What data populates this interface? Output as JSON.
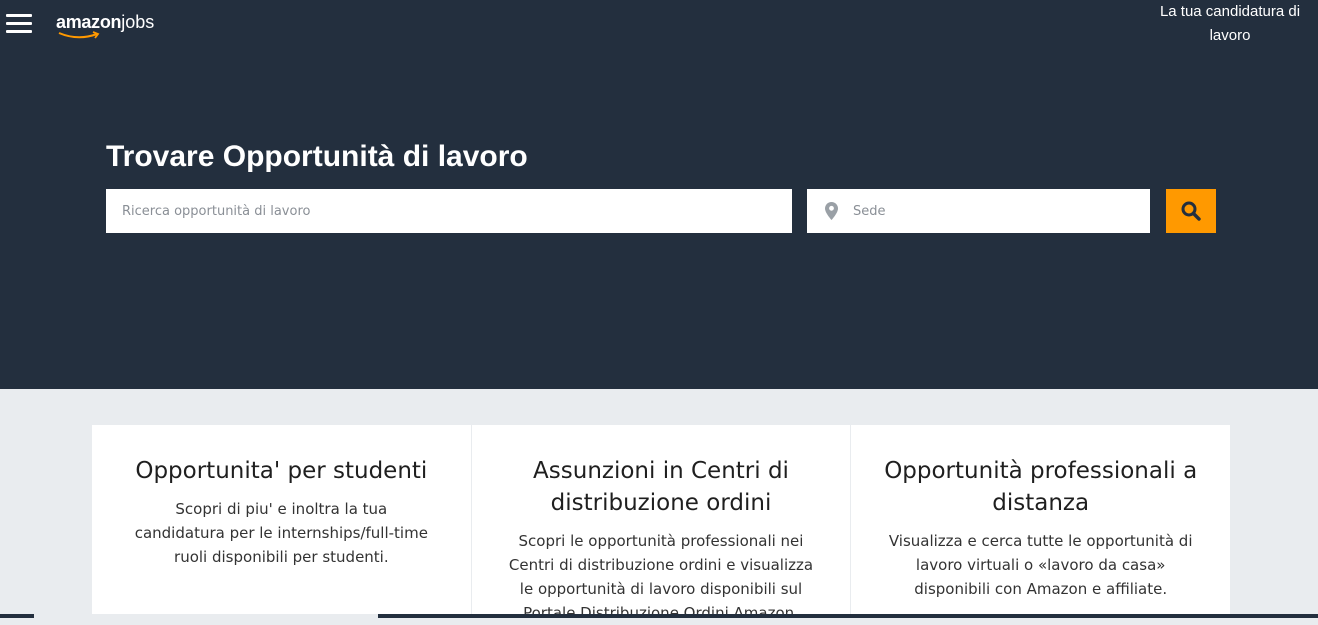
{
  "header": {
    "logo_amazon": "amazon",
    "logo_jobs": "jobs",
    "apply_link": "La tua candidatura di lavoro"
  },
  "hero": {
    "title": "Trovare Opportunità di lavoro",
    "search_placeholder": "Ricerca opportunità di lavoro",
    "location_placeholder": "Sede"
  },
  "cards": [
    {
      "title": "Opportunita' per studenti",
      "text": "Scopri di piu' e inoltra la tua candidatura per le internships/full-time ruoli disponibili per studenti."
    },
    {
      "title": "Assunzioni in Centri di distribuzione ordini",
      "text": "Scopri le opportunità professionali nei Centri di distribuzione ordini e visualizza le opportunità di lavoro disponibili sul Portale Distribuzione Ordini Amazon."
    },
    {
      "title": "Opportunità professionali a distanza",
      "text": "Visualizza e cerca tutte le opportunità di lavoro virtuali o «lavoro da casa» disponibili con Amazon e affiliate."
    }
  ],
  "colors": {
    "navy": "#232f3e",
    "accent": "#ff9900",
    "background": "#e9ecef"
  },
  "icons": {
    "menu": "hamburger-menu-icon",
    "location": "map-pin-icon",
    "search": "magnifier-icon"
  }
}
